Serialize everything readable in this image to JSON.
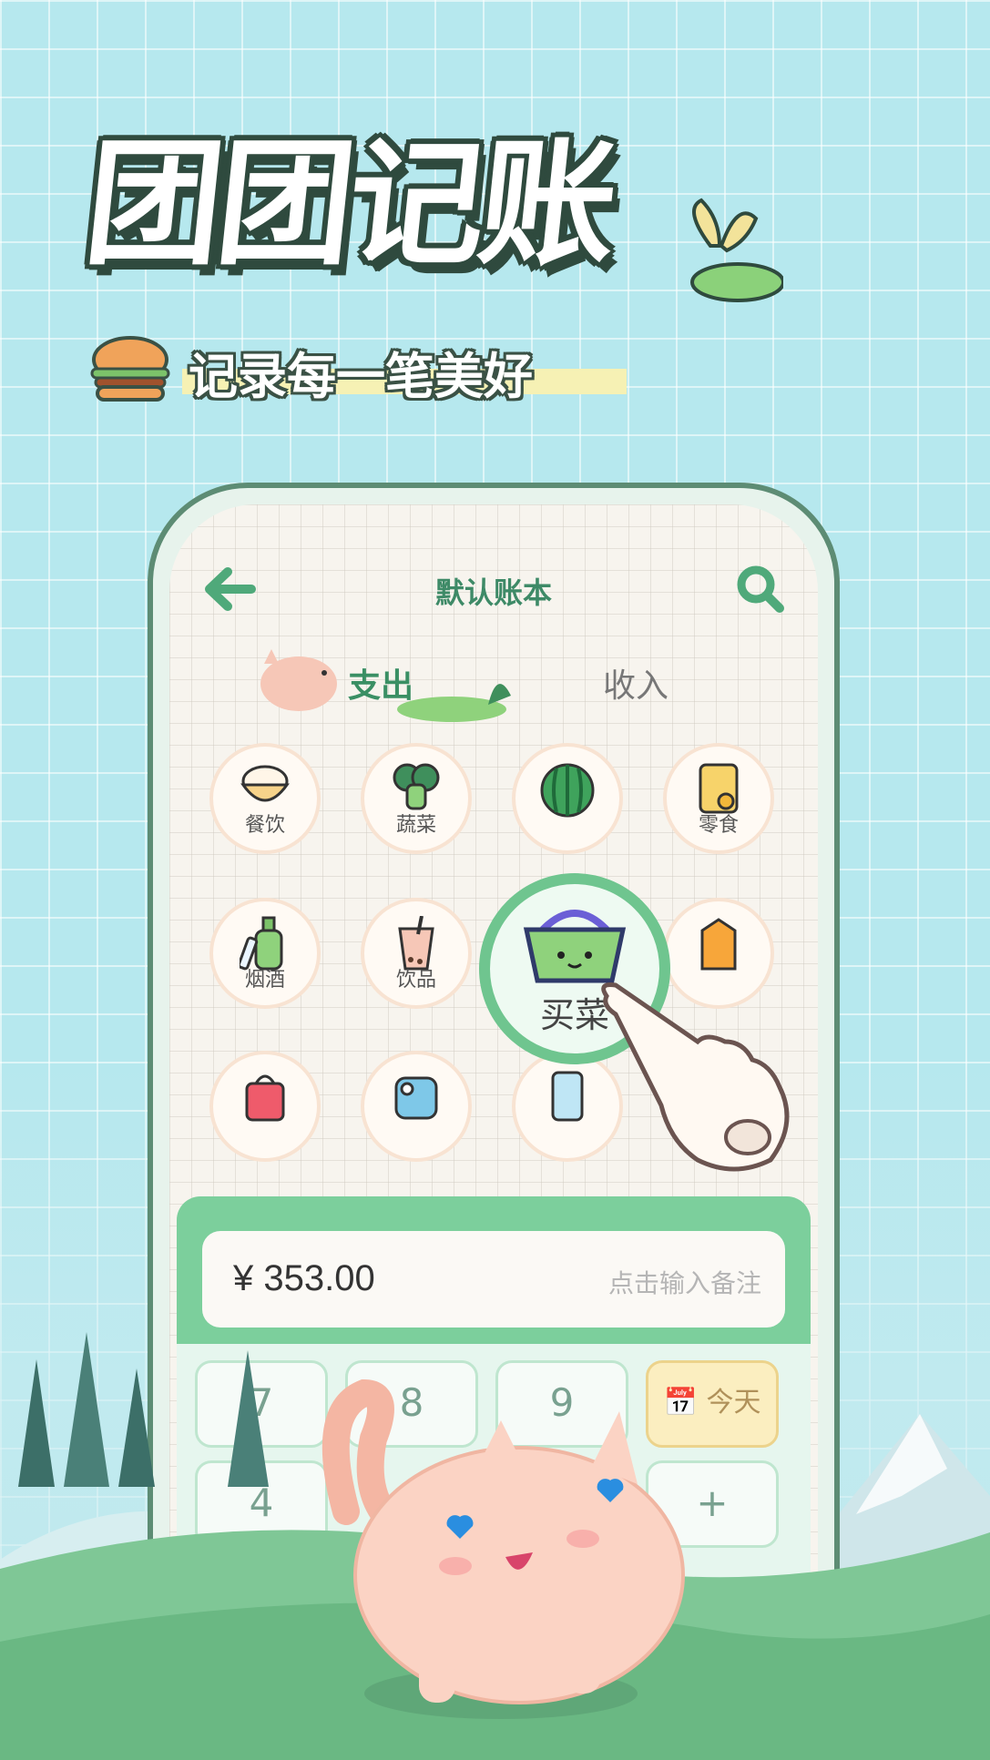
{
  "header": {
    "app_title": "团团记账",
    "slogan": "记录每一笔美好"
  },
  "phone": {
    "book_title": "默认账本",
    "tabs": {
      "expense": "支出",
      "income": "收入"
    },
    "categories": [
      {
        "label": "餐饮",
        "icon": "rice-bowl-icon"
      },
      {
        "label": "蔬菜",
        "icon": "broccoli-icon"
      },
      {
        "label": "",
        "icon": "watermelon-icon"
      },
      {
        "label": "零食",
        "icon": "snack-bag-icon"
      },
      {
        "label": "烟酒",
        "icon": "bottle-icon"
      },
      {
        "label": "饮品",
        "icon": "bubble-tea-icon"
      },
      {
        "label": "",
        "icon": "milk-carton-icon"
      },
      {
        "label": "",
        "icon": "shopping-bag-icon"
      },
      {
        "label": "",
        "icon": "toilet-paper-icon"
      },
      {
        "label": "",
        "icon": "phone-icon"
      },
      {
        "label": "",
        "icon": "pig-icon"
      }
    ],
    "selected_category": {
      "label": "买菜",
      "icon": "basket-icon"
    },
    "amount": "¥ 353.00",
    "note_placeholder": "点击输入备注",
    "keys": {
      "k7": "7",
      "k8": "8",
      "k9": "9",
      "today": "今天",
      "k4": "4",
      "plus": "+"
    }
  },
  "colors": {
    "accent": "#3e8a67",
    "pad": "#7ccf9c"
  }
}
